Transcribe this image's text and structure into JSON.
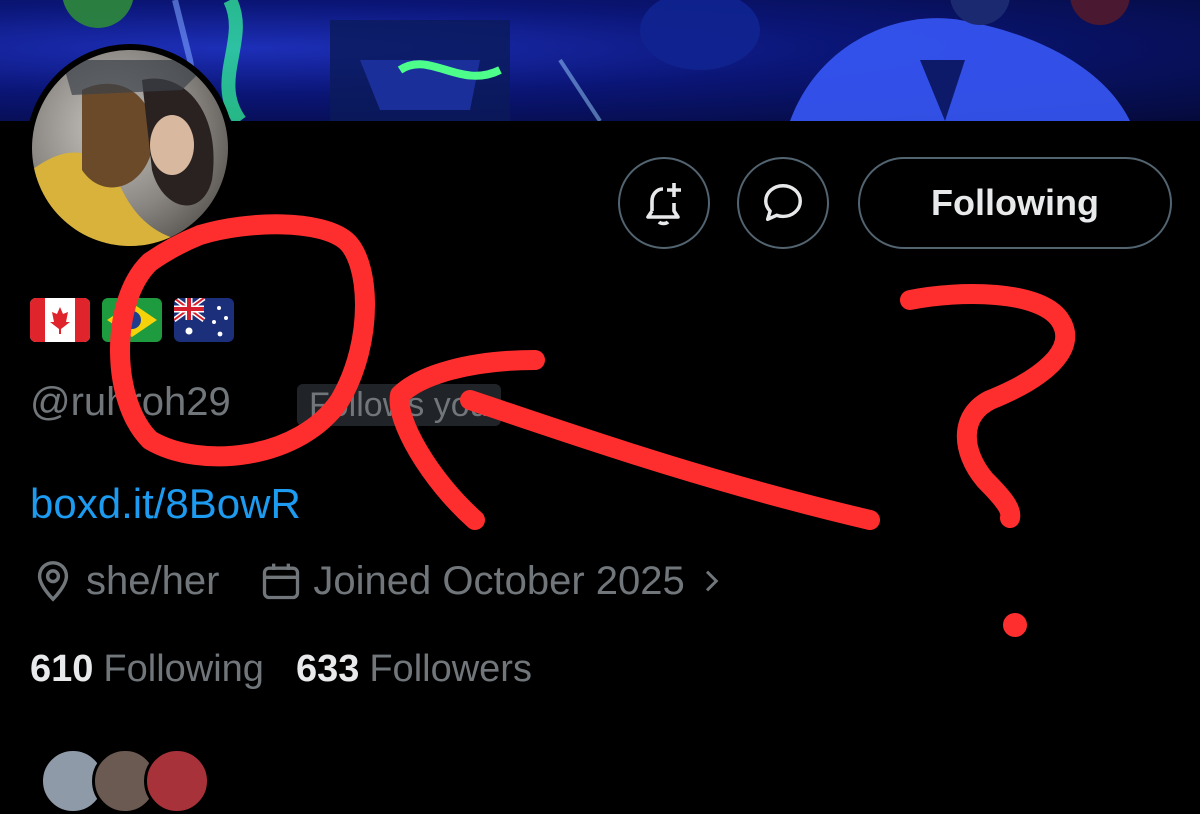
{
  "banner": {
    "colors": {
      "base": "#0a1575",
      "glow": "#22ff88"
    }
  },
  "profile": {
    "flags": [
      "canada-flag",
      "brazil-flag",
      "australia-flag"
    ],
    "handle": "@ruhroh29",
    "follows_badge": "Follows you",
    "link": "boxd.it/8BowR",
    "location": "she/her",
    "joined": "Joined October 2025",
    "following_count": "610",
    "following_label": "Following",
    "followers_count": "633",
    "followers_label": "Followers"
  },
  "actions": {
    "notify_icon": "bell-plus-icon",
    "message_icon": "message-bubble-icon",
    "following_button": "Following"
  },
  "annotation": {
    "color": "#ff2e2e",
    "question_mark": "?"
  }
}
